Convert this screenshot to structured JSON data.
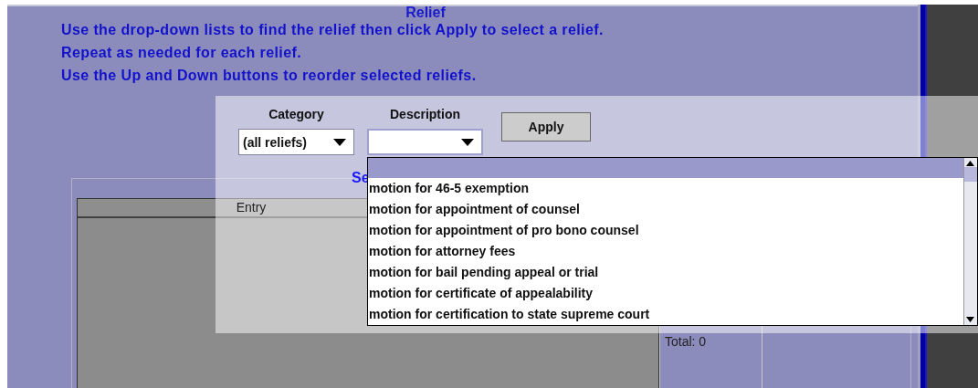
{
  "panel": {
    "title": "Relief",
    "instructions": [
      "Use the drop-down lists to find the relief then click Apply to select a relief.",
      "Repeat as needed for each relief.",
      "Use the Up and Down buttons to reorder selected reliefs."
    ]
  },
  "selected_group": {
    "title": "Se",
    "table": {
      "columns": [
        "Entry"
      ]
    },
    "total": "Total: 0"
  },
  "selector": {
    "category": {
      "label": "Category",
      "value": "(all reliefs)"
    },
    "description": {
      "label": "Description"
    },
    "apply_button": "Apply"
  },
  "dropdown_list": {
    "items": [
      {
        "label": "motion for 46-5 exemption",
        "selected": false
      },
      {
        "label": "motion for appointment of counsel",
        "selected": false
      },
      {
        "label": "motion for appointment of pro bono counsel",
        "selected": false
      },
      {
        "label": "motion for attorney fees",
        "selected": false
      },
      {
        "label": "motion for bail pending appeal or trial",
        "selected": false
      },
      {
        "label": "motion for certificate of appealability",
        "selected": false
      },
      {
        "label": "motion for certification to state supreme court",
        "selected": false
      }
    ]
  }
}
